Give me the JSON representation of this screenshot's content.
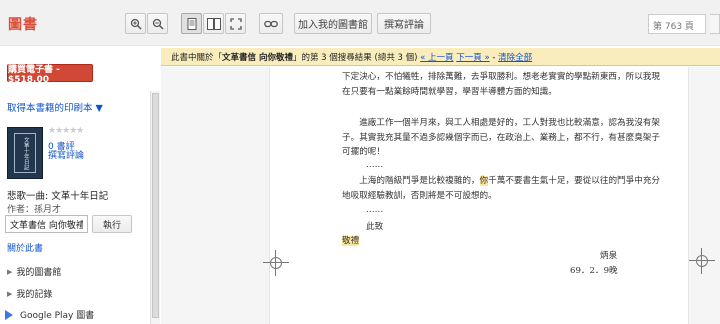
{
  "app": {
    "logo": "圖書"
  },
  "toolbar": {
    "add_library_label": "加入我的圖書館",
    "write_review_label": "撰寫評論",
    "page_label": "第 763 頁"
  },
  "sidebar": {
    "buy_label": "購買電子書 - $518.00",
    "print_copy_label": "取得本書籍的印刷本 ▼",
    "cover_text": "文革十年日記",
    "reviews_count": "0 書評",
    "write_review": "撰寫評論",
    "book_title": "悲歌一曲: 文革十年日記",
    "author": "作者：孫月才",
    "search_value": "文革書信 向你敬禮",
    "go_label": "執行",
    "about_label": "關於此書",
    "items": [
      {
        "label": "我的圖書館"
      },
      {
        "label": "我的記錄"
      }
    ],
    "play_books_label": "Google Play 圖書"
  },
  "resultbar": {
    "prefix": "此書中關於「",
    "query": "文革書信 向你敬禮",
    "middle": "」的第 3 個搜尋結果 (總共 3 個) ",
    "prev": "« 上一頁",
    "next": "下一頁 »",
    "clear": "清除全部"
  },
  "page": {
    "p1": "下定決心，不怕犧牲，排除萬難，去爭取勝利。想老老實實的學點新東西，所以我現在只要有一點業餘時間就學習，學習半導體方面的知識。",
    "p2": "進廠工作一個半月來，與工人相處是好的，工人對我也比較滿意，認為我沒有架子。其實我充其量不過多認幾個字而已，在政治上、業務上，都不行，有甚麼臭架子可擺的呢！",
    "e1": "……",
    "p3_before": "上海的階級鬥爭是比較複雜的，",
    "p3_hl": "你",
    "p3_after": "千萬不要書生氣十足，要從以往的鬥爭中充分地吸取經驗教訓，否則將是不可設想的。",
    "e2": "……",
    "closing1": "此致",
    "closing2": "敬禮",
    "sign_name": "炳泉",
    "sign_date": "69．2．9晚"
  }
}
